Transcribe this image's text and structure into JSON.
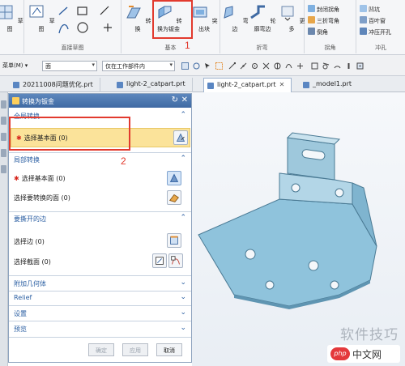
{
  "ribbon": {
    "groups": [
      {
        "label": "直接草图"
      },
      {
        "label": "基本"
      },
      {
        "label": "折弯"
      },
      {
        "label": "拐角"
      },
      {
        "label": "冲孔"
      }
    ],
    "left_cut_label": "草图",
    "sketch_tool": "草图",
    "buttons": {
      "convert": "转换",
      "convert_to_sheet": "转换为钣金",
      "outsole": "突出块",
      "bend": "弯边",
      "contour_bend": "轮廓弯边",
      "more": "更多"
    },
    "corner_items": [
      "封闭拐角",
      "三折弯角",
      "倒角"
    ],
    "punch_items": [
      "凹坑",
      "百叶窗",
      "冲压开孔"
    ],
    "annotation_1": "1",
    "accent": "#e23a2e"
  },
  "selection_bar": {
    "menu": "菜单(M) ▾",
    "filter": "面",
    "scope": "仅在工作部件内"
  },
  "tabs": [
    {
      "label": "20211008问题优化.prt"
    },
    {
      "label": "light-2_catpart.prt"
    },
    {
      "label": "light-2_catpart.prt"
    },
    {
      "label": "_model1.prt"
    }
  ],
  "dialog": {
    "title": "转换为钣金",
    "sections": {
      "global": "全局转换",
      "local": "局部转换",
      "rip": "要撕开的边",
      "attach": "附加几何体",
      "relief": "Relief",
      "settings": "设置",
      "preview": "预览"
    },
    "global_row": "选择基本面 (0)",
    "local_rows": [
      "选择基本面 (0)",
      "选择要转换的面 (0)"
    ],
    "rip_rows": [
      "选择边 (0)",
      "选择截面 (0)"
    ],
    "annotation_2": "2",
    "buttons": {
      "ok": "确定",
      "apply": "应用",
      "cancel": "取消"
    }
  },
  "watermark": {
    "text": "软件技巧",
    "logo": "php",
    "site": "中文网"
  }
}
